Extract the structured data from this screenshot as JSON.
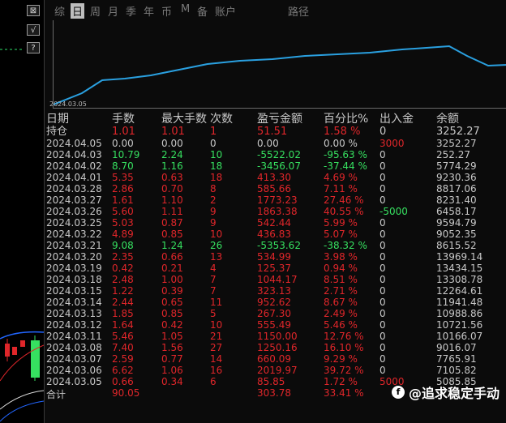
{
  "tabs": [
    "综",
    "日",
    "周",
    "月",
    "季",
    "年",
    "币",
    "M",
    "备",
    "账户",
    "路径"
  ],
  "active_tab": "日",
  "side_buttons": [
    "⊠",
    "√",
    "?"
  ],
  "curve": {
    "start_date_label": "2024.03.05",
    "line_color": "#2aa0e0"
  },
  "table": {
    "headers": [
      "日期",
      "手数",
      "最大手数",
      "次数",
      "盈亏金额",
      "百分比%",
      "出入金",
      "余额"
    ],
    "position_row": {
      "label": "持仓",
      "lots": "1.01",
      "max_lots": "1.01",
      "count": "1",
      "pnl": "51.51",
      "percent": "1.58 %",
      "flow": "0",
      "balance": "3252.27"
    },
    "rows": [
      {
        "date": "2024.04.05",
        "lots": "0.00",
        "max_lots": "0.00",
        "count": "0",
        "pnl": "0.00",
        "percent": "0.00 %",
        "flow": "3000",
        "balance": "3252.27",
        "tone": "gray",
        "flow_tone": "red"
      },
      {
        "date": "2024.04.03",
        "lots": "10.79",
        "max_lots": "2.24",
        "count": "10",
        "pnl": "-5522.02",
        "percent": "-95.63 %",
        "flow": "0",
        "balance": "252.27",
        "tone": "green",
        "flow_tone": "gray"
      },
      {
        "date": "2024.04.02",
        "lots": "8.70",
        "max_lots": "1.16",
        "count": "18",
        "pnl": "-3456.07",
        "percent": "-37.44 %",
        "flow": "0",
        "balance": "5774.29",
        "tone": "green",
        "flow_tone": "gray"
      },
      {
        "date": "2024.04.01",
        "lots": "5.35",
        "max_lots": "0.63",
        "count": "18",
        "pnl": "413.30",
        "percent": "4.69 %",
        "flow": "0",
        "balance": "9230.36",
        "tone": "red",
        "flow_tone": "gray"
      },
      {
        "date": "2024.03.28",
        "lots": "2.86",
        "max_lots": "0.70",
        "count": "8",
        "pnl": "585.66",
        "percent": "7.11 %",
        "flow": "0",
        "balance": "8817.06",
        "tone": "red",
        "flow_tone": "gray"
      },
      {
        "date": "2024.03.27",
        "lots": "1.61",
        "max_lots": "1.10",
        "count": "2",
        "pnl": "1773.23",
        "percent": "27.46 %",
        "flow": "0",
        "balance": "8231.40",
        "tone": "red",
        "flow_tone": "gray"
      },
      {
        "date": "2024.03.26",
        "lots": "5.60",
        "max_lots": "1.11",
        "count": "9",
        "pnl": "1863.38",
        "percent": "40.55 %",
        "flow": "-5000",
        "balance": "6458.17",
        "tone": "red",
        "flow_tone": "green"
      },
      {
        "date": "2024.03.25",
        "lots": "5.03",
        "max_lots": "0.87",
        "count": "9",
        "pnl": "542.44",
        "percent": "5.99 %",
        "flow": "0",
        "balance": "9594.79",
        "tone": "red",
        "flow_tone": "gray"
      },
      {
        "date": "2024.03.22",
        "lots": "4.89",
        "max_lots": "0.85",
        "count": "10",
        "pnl": "436.83",
        "percent": "5.07 %",
        "flow": "0",
        "balance": "9052.35",
        "tone": "red",
        "flow_tone": "gray"
      },
      {
        "date": "2024.03.21",
        "lots": "9.08",
        "max_lots": "1.24",
        "count": "26",
        "pnl": "-5353.62",
        "percent": "-38.32 %",
        "flow": "0",
        "balance": "8615.52",
        "tone": "green",
        "flow_tone": "gray"
      },
      {
        "date": "2024.03.20",
        "lots": "2.35",
        "max_lots": "0.66",
        "count": "13",
        "pnl": "534.99",
        "percent": "3.98 %",
        "flow": "0",
        "balance": "13969.14",
        "tone": "red",
        "flow_tone": "gray"
      },
      {
        "date": "2024.03.19",
        "lots": "0.42",
        "max_lots": "0.21",
        "count": "4",
        "pnl": "125.37",
        "percent": "0.94 %",
        "flow": "0",
        "balance": "13434.15",
        "tone": "red",
        "flow_tone": "gray"
      },
      {
        "date": "2024.03.18",
        "lots": "2.48",
        "max_lots": "1.00",
        "count": "7",
        "pnl": "1044.17",
        "percent": "8.51 %",
        "flow": "0",
        "balance": "13308.78",
        "tone": "red",
        "flow_tone": "gray"
      },
      {
        "date": "2024.03.15",
        "lots": "1.22",
        "max_lots": "0.39",
        "count": "7",
        "pnl": "323.13",
        "percent": "2.71 %",
        "flow": "0",
        "balance": "12264.61",
        "tone": "red",
        "flow_tone": "gray"
      },
      {
        "date": "2024.03.14",
        "lots": "2.44",
        "max_lots": "0.65",
        "count": "11",
        "pnl": "952.62",
        "percent": "8.67 %",
        "flow": "0",
        "balance": "11941.48",
        "tone": "red",
        "flow_tone": "gray"
      },
      {
        "date": "2024.03.13",
        "lots": "1.85",
        "max_lots": "0.85",
        "count": "5",
        "pnl": "267.30",
        "percent": "2.49 %",
        "flow": "0",
        "balance": "10988.86",
        "tone": "red",
        "flow_tone": "gray"
      },
      {
        "date": "2024.03.12",
        "lots": "1.64",
        "max_lots": "0.42",
        "count": "10",
        "pnl": "555.49",
        "percent": "5.46 %",
        "flow": "0",
        "balance": "10721.56",
        "tone": "red",
        "flow_tone": "gray"
      },
      {
        "date": "2024.03.11",
        "lots": "5.46",
        "max_lots": "1.05",
        "count": "21",
        "pnl": "1150.00",
        "percent": "12.76 %",
        "flow": "0",
        "balance": "10166.07",
        "tone": "red",
        "flow_tone": "gray"
      },
      {
        "date": "2024.03.08",
        "lots": "7.40",
        "max_lots": "1.56",
        "count": "27",
        "pnl": "1250.16",
        "percent": "16.10 %",
        "flow": "0",
        "balance": "9016.07",
        "tone": "red",
        "flow_tone": "gray"
      },
      {
        "date": "2024.03.07",
        "lots": "2.59",
        "max_lots": "0.77",
        "count": "14",
        "pnl": "660.09",
        "percent": "9.29 %",
        "flow": "0",
        "balance": "7765.91",
        "tone": "red",
        "flow_tone": "gray"
      },
      {
        "date": "2024.03.06",
        "lots": "6.62",
        "max_lots": "1.06",
        "count": "16",
        "pnl": "2019.97",
        "percent": "39.72 %",
        "flow": "0",
        "balance": "7105.82",
        "tone": "red",
        "flow_tone": "gray"
      },
      {
        "date": "2024.03.05",
        "lots": "0.66",
        "max_lots": "0.34",
        "count": "6",
        "pnl": "85.85",
        "percent": "1.72 %",
        "flow": "5000",
        "balance": "5085.85",
        "tone": "red",
        "flow_tone": "red"
      }
    ],
    "total_row": {
      "label": "合计",
      "lots": "90.05",
      "pnl": "303.78",
      "percent": "33.41 %"
    }
  },
  "watermark": {
    "logo": "f",
    "text": "@追求稳定手动"
  }
}
